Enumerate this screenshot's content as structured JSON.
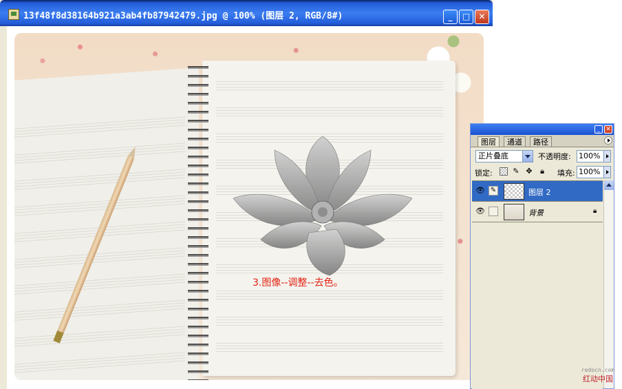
{
  "document_window": {
    "title": "13f48f8d38164b921a3ab4fb87942479.jpg @ 100% (图层 2, RGB/8#)",
    "icon": "photoshop-document-icon",
    "controls": {
      "minimize": "_",
      "maximize": "□",
      "close": "✕"
    }
  },
  "canvas": {
    "caption": "3.图像--调整--去色。",
    "caption_color": "#e32212"
  },
  "layers_panel": {
    "controls": {
      "minimize": "_",
      "close": "✕"
    },
    "tabs": [
      {
        "label": "图层",
        "active": true
      },
      {
        "label": "通道",
        "active": false
      },
      {
        "label": "路径",
        "active": false
      }
    ],
    "blend_mode": "正片叠底",
    "opacity_label": "不透明度:",
    "opacity_value": "100%",
    "lock_label": "锁定:",
    "fill_label": "填充:",
    "fill_value": "100%",
    "layers": [
      {
        "name": "图层 2",
        "visible": true,
        "selected": true,
        "icon": "brush-icon"
      },
      {
        "name": "背景",
        "visible": true,
        "selected": false,
        "locked": true
      }
    ],
    "selection_color": "#316ac5"
  },
  "site_watermark": {
    "url": "redocn.com",
    "name": "红动中国"
  }
}
